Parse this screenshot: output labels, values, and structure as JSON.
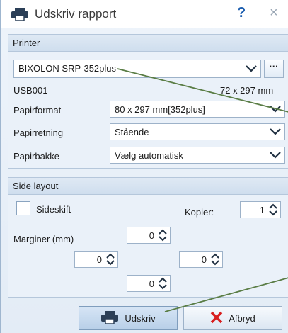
{
  "window": {
    "title": "Udskriv rapport",
    "help_label": "?",
    "close_label": "×"
  },
  "printer_section": {
    "header": "Printer",
    "printer_name": "BIXOLON SRP-352plus",
    "more_label": "···",
    "port": "USB001",
    "paper_size_info": "72 x 297 mm",
    "fields": [
      {
        "label": "Papirformat",
        "value": "80 x 297 mm[352plus]"
      },
      {
        "label": "Papirretning",
        "value": "Stående"
      },
      {
        "label": "Papirbakke",
        "value": "Vælg automatisk"
      }
    ]
  },
  "layout_section": {
    "header": "Side layout",
    "page_break_label": "Sideskift",
    "page_break_checked": false,
    "copies_label": "Kopier:",
    "copies_value": "1",
    "margins_label": "Marginer (mm)",
    "margin_top": "0",
    "margin_left": "0",
    "margin_right": "0",
    "margin_bottom": "0"
  },
  "actions": {
    "print_label": "Udskriv",
    "cancel_label": "Afbryd"
  },
  "colors": {
    "accent": "#1e5fb0",
    "cancel_red": "#d81f1f",
    "annotation_line": "#5a7d45"
  },
  "icons": [
    "printer-icon",
    "help-icon",
    "close-icon",
    "chevron-down-icon",
    "ellipsis-icon",
    "spin-up-icon",
    "spin-down-icon",
    "cancel-x-icon"
  ]
}
